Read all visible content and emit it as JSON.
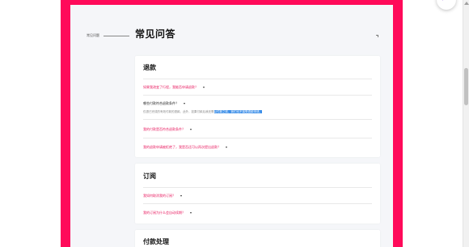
{
  "nav": {
    "section_label": "常见问题"
  },
  "page": {
    "title": "常见问答"
  },
  "refund": {
    "title": "退款",
    "q1": "如果我改变了行程，我能否申请退款？",
    "q2": "哪些付款符合退款条件？",
    "a2_plain": "仅退已完成的有效付款的退款。此外，如果付款后我还需",
    "a2_highlight": "以付款之前，我们也不接受退款申请。",
    "q3": "我的付款是否符合退款条件？",
    "q4": "我的退款申请被拒绝了，我是否还可以再次提出退款？"
  },
  "subscription": {
    "title": "订阅",
    "q1": "我如何取消我的订阅？",
    "q2": "我的订阅为什么会自动续期？"
  },
  "payment": {
    "title": "付款处理"
  },
  "colors": {
    "frame": "#ff0a5a",
    "link": "#e8175d",
    "highlight": "#3b8ee8"
  }
}
